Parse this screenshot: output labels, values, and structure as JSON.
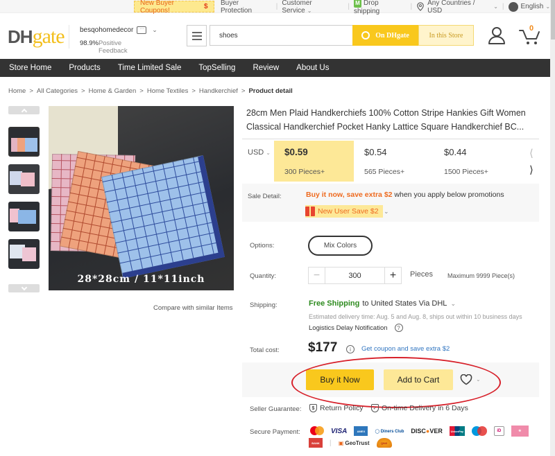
{
  "topbar": {
    "coupon_label": "New Buyer Coupons!",
    "coupon_symbol": "$",
    "buyer_protection": "Buyer Protection",
    "customer_service": "Customer Service",
    "drop_shipping": "Drop shipping",
    "region": "Any Countries / USD",
    "language": "English"
  },
  "header": {
    "logo_dh": "DH",
    "logo_gate": "gate",
    "store_name": "besqohomedecor",
    "feedback_percent": "98.9%",
    "feedback_label": "Positive Feedback",
    "search_value": "shoes",
    "search_on_dhgate": "On DHgate",
    "search_in_store": "In this Store",
    "cart_count": "0"
  },
  "nav": {
    "items": [
      "Store Home",
      "Products",
      "Time Limited Sale",
      "TopSelling",
      "Review",
      "About Us"
    ]
  },
  "breadcrumb": {
    "items": [
      "Home",
      "All Categories",
      "Home & Garden",
      "Home Textiles",
      "Handkerchief"
    ],
    "current": "Product detail",
    "separator": ">"
  },
  "gallery": {
    "image_caption": "28*28cm / 11*11inch",
    "compare_label": "Compare with similar Items",
    "thumbnail_count": 4,
    "selected_thumbnail": 1
  },
  "product": {
    "title": "28cm Men Plaid Handkerchiefs 100% Cotton Stripe Hankies Gift Women Classical Handkerchief Pocket Hanky Lattice Square Handkerchief BC...",
    "currency": "USD",
    "price_tiers": [
      {
        "price": "$0.59",
        "qty": "300 Pieces+",
        "selected": true
      },
      {
        "price": "$0.54",
        "qty": "565 Pieces+",
        "selected": false
      },
      {
        "price": "$0.44",
        "qty": "1500 Pieces+",
        "selected": false
      }
    ],
    "sale_detail_label": "Sale Detail:",
    "sale_highlight": "Buy it now, save extra $2",
    "sale_rest": "when you apply below promotions",
    "new_user_badge": "New User Save $2",
    "options_label": "Options:",
    "option_value": "Mix Colors",
    "quantity_label": "Quantity:",
    "quantity_value": "300",
    "quantity_unit": "Pieces",
    "quantity_max": "Maximum 9999 Piece(s)",
    "shipping_label": "Shipping:",
    "shipping_free": "Free Shipping",
    "shipping_dest": "to United States Via DHL",
    "estimated_delivery": "Estimated delivery time: Aug. 5 and Aug. 8, ships out within 10 business days",
    "logistics_notice": "Logistics Delay Notification",
    "total_label": "Total cost:",
    "total_value": "$177",
    "coupon_link": "Get coupon and save extra $2",
    "buy_now": "Buy it Now",
    "add_to_cart": "Add to Cart",
    "guarantee_label": "Seller Guarantee:",
    "return_policy": "Return Policy",
    "ontime_delivery": "On-time Delivery in 6 Days",
    "payment_label": "Secure Payment:",
    "payment_methods": [
      "Mastercard",
      "VISA",
      "American Express",
      "Diners Club",
      "DISCOVER",
      "UnionPay",
      "Maestro",
      "iDEAL",
      "Bancontact",
      "Bank Transfer",
      "GeoTrust",
      "Qiwi"
    ]
  },
  "colors": {
    "accent_yellow": "#f9c81d",
    "light_yellow": "#fde897",
    "nav_bg": "#333333",
    "promo_orange": "#ee6a1f",
    "free_shipping_green": "#2e8b1f",
    "link_blue": "#2f74c0",
    "annotation_red": "#d7202a"
  }
}
